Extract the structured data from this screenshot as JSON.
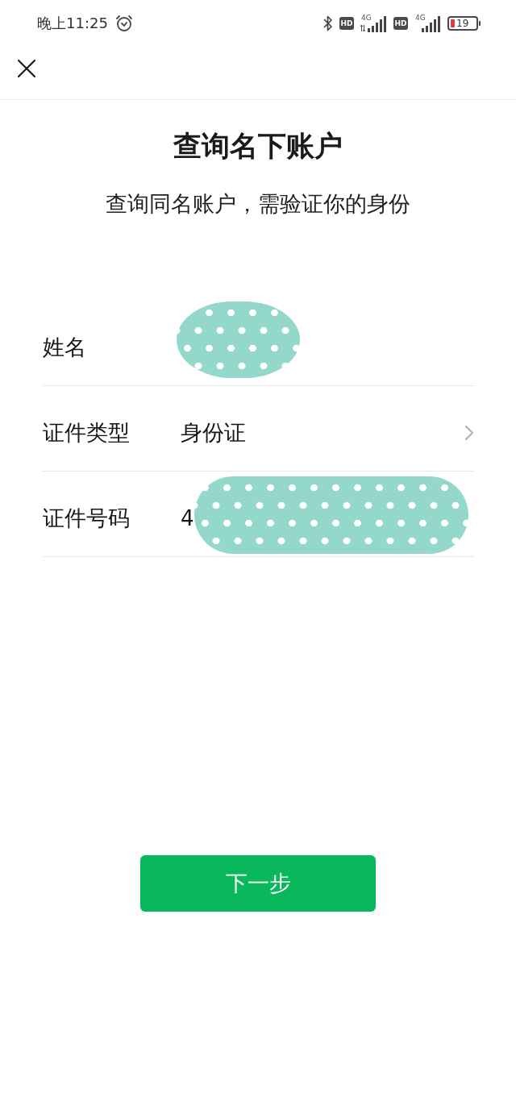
{
  "status_bar": {
    "time": "晚上11:25",
    "sims": [
      {
        "badge": "HD",
        "network": "4G",
        "activity": true
      },
      {
        "badge": "HD",
        "network": "4G",
        "activity": false
      }
    ],
    "battery": "19"
  },
  "title": "查询名下账户",
  "subtitle": "查询同名账户，需验证你的身份",
  "form": {
    "rows": [
      {
        "kind": "input",
        "label": "姓名",
        "redacted": true
      },
      {
        "kind": "select",
        "label": "证件类型",
        "value": "身份证",
        "redacted": false
      },
      {
        "kind": "input",
        "label": "证件号码",
        "value": "4",
        "redacted": true
      }
    ]
  },
  "primary_button": "下一步"
}
